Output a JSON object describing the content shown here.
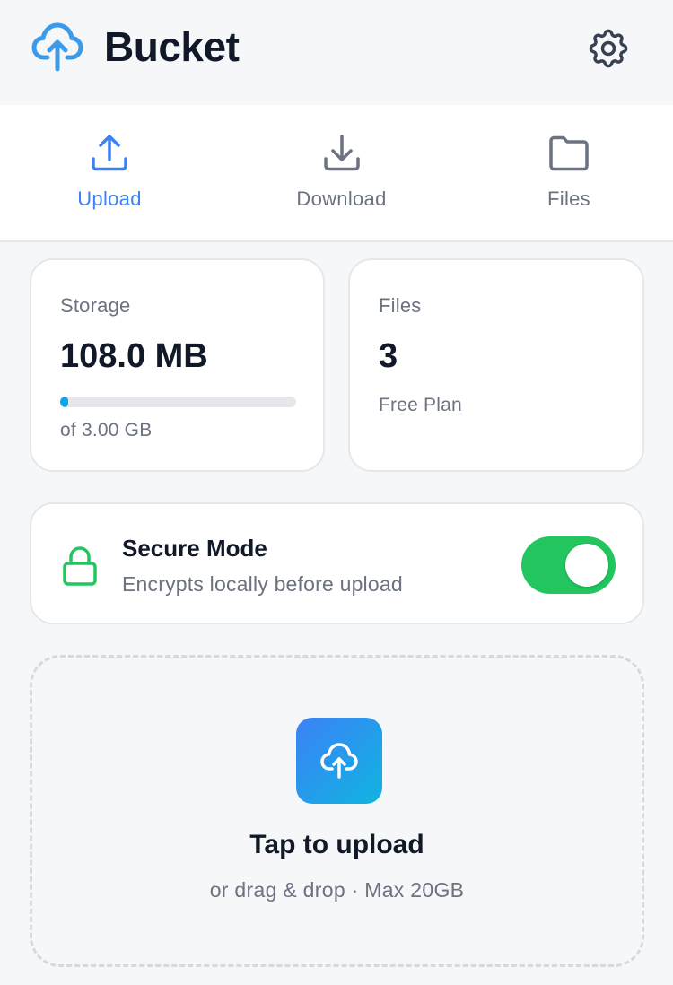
{
  "app": {
    "title": "Bucket",
    "logo_icon": "cloud-upload-icon",
    "settings_icon": "gear-icon",
    "accent_color": "#3b82f6"
  },
  "tabs": [
    {
      "label": "Upload",
      "icon": "upload-icon",
      "active": true
    },
    {
      "label": "Download",
      "icon": "download-icon",
      "active": false
    },
    {
      "label": "Files",
      "icon": "folder-icon",
      "active": false
    }
  ],
  "storage": {
    "label": "Storage",
    "used": "108.0 MB",
    "total_text": "of 3.00 GB",
    "used_fraction": 0.035,
    "bar_color": "#0ea5e9"
  },
  "files": {
    "label": "Files",
    "count": "3",
    "plan": "Free Plan"
  },
  "secure_mode": {
    "title": "Secure Mode",
    "description": "Encrypts locally before upload",
    "enabled": true,
    "icon": "lock-icon",
    "toggle_color": "#22c55e"
  },
  "dropzone": {
    "title": "Tap to upload",
    "subtitle": "or drag & drop · Max 20GB",
    "icon": "cloud-upload-icon"
  }
}
